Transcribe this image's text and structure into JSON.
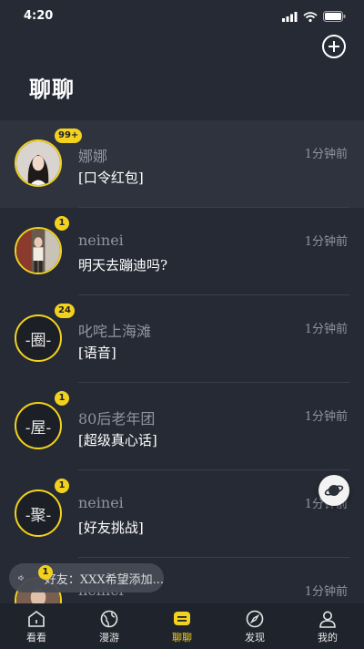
{
  "status": {
    "time": "4:20"
  },
  "header": {
    "title": "聊聊"
  },
  "conversations": [
    {
      "name": "娜娜",
      "message": "[口令红包]",
      "time": "1分钟前",
      "badge": "99+",
      "avatar_type": "photo",
      "group_label": ""
    },
    {
      "name": "neinei",
      "message": "明天去蹦迪吗?",
      "time": "1分钟前",
      "badge": "1",
      "avatar_type": "photo",
      "group_label": ""
    },
    {
      "name": "叱咤上海滩",
      "message": "[语音]",
      "time": "1分钟前",
      "badge": "24",
      "avatar_type": "group",
      "group_label": "-圈-"
    },
    {
      "name": "80后老年团",
      "message": "[超级真心话]",
      "time": "1分钟前",
      "badge": "1",
      "avatar_type": "group",
      "group_label": "-屋-"
    },
    {
      "name": "neinei",
      "message": "[好友挑战]",
      "time": "1分钟前",
      "badge": "1",
      "avatar_type": "group",
      "group_label": "-聚-"
    },
    {
      "name": "neinei",
      "message": "",
      "time": "1分钟前",
      "badge": "",
      "avatar_type": "photo",
      "group_label": ""
    }
  ],
  "toast": {
    "badge": "1",
    "text": "好友：XXX希望添加..."
  },
  "tabs": [
    {
      "label": "看看",
      "icon": "house-icon",
      "active": false
    },
    {
      "label": "漫游",
      "icon": "globe-icon",
      "active": false
    },
    {
      "label": "聊聊",
      "icon": "chat-icon",
      "active": true
    },
    {
      "label": "发现",
      "icon": "compass-icon",
      "active": false
    },
    {
      "label": "我的",
      "icon": "person-icon",
      "active": false
    }
  ],
  "colors": {
    "background": "#262a34",
    "accent": "#f2d21e",
    "muted_text": "#8f94a0",
    "tab_bar": "#1f232c"
  }
}
